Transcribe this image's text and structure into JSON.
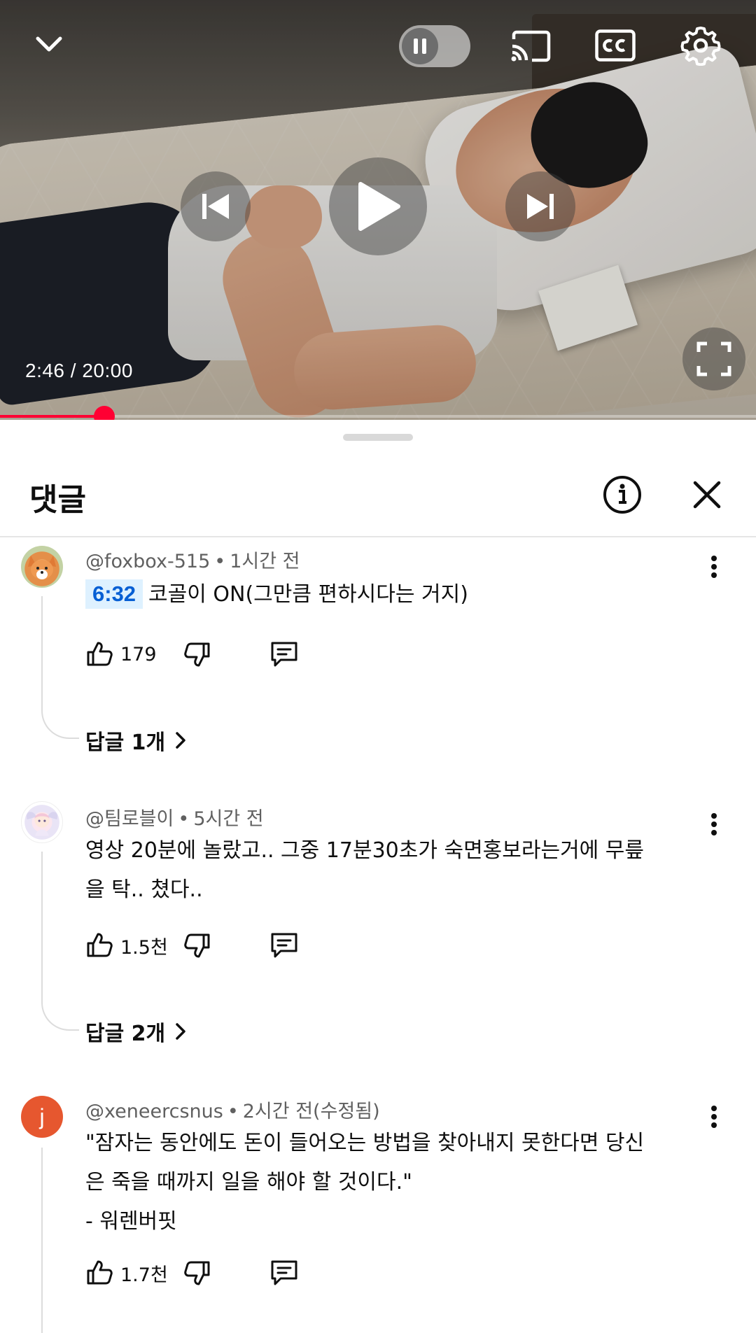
{
  "player": {
    "time_current": "2:46",
    "time_total": "20:00",
    "time_display": "2:46 / 20:00",
    "progress": 0.138,
    "progress_color": "#ff0033",
    "icons": [
      "chevron-down-icon",
      "pause-icon",
      "cast-icon",
      "captions-icon",
      "settings-gear-icon",
      "skip-previous-icon",
      "play-icon",
      "skip-next-icon",
      "fullscreen-icon"
    ]
  },
  "panel": {
    "title": "댓글",
    "icons": [
      "info-icon",
      "close-icon"
    ]
  },
  "comments": [
    {
      "author": "@foxbox-515",
      "age": "1시간 전",
      "timestamp_link": "6:32",
      "text": "코골이 ON(그만큼 편하시다는 거지)",
      "likes": "179",
      "replies_label": "답글 1개"
    },
    {
      "author": "@팀로블이",
      "age": "5시간 전",
      "text_line1": "영상 20분에 놀랐고.. 그중 17분30초가 숙면홍보라는거에 무릎",
      "text_line2": "을 탁.. 쳤다..",
      "likes": "1.5천",
      "replies_label": "답글 2개"
    },
    {
      "author": "@xeneercsnus",
      "age": "2시간 전(수정됨)",
      "avatar_letter": "j",
      "avatar_color": "#e6572f",
      "text_line1": "\"잠자는 동안에도 돈이 들어오는 방법을 찾아내지 못한다면 당신",
      "text_line2": "은 죽을 때까지 일을 해야 할 것이다.\"",
      "text_line3": "- 워렌버핏",
      "likes": "1.7천"
    }
  ]
}
